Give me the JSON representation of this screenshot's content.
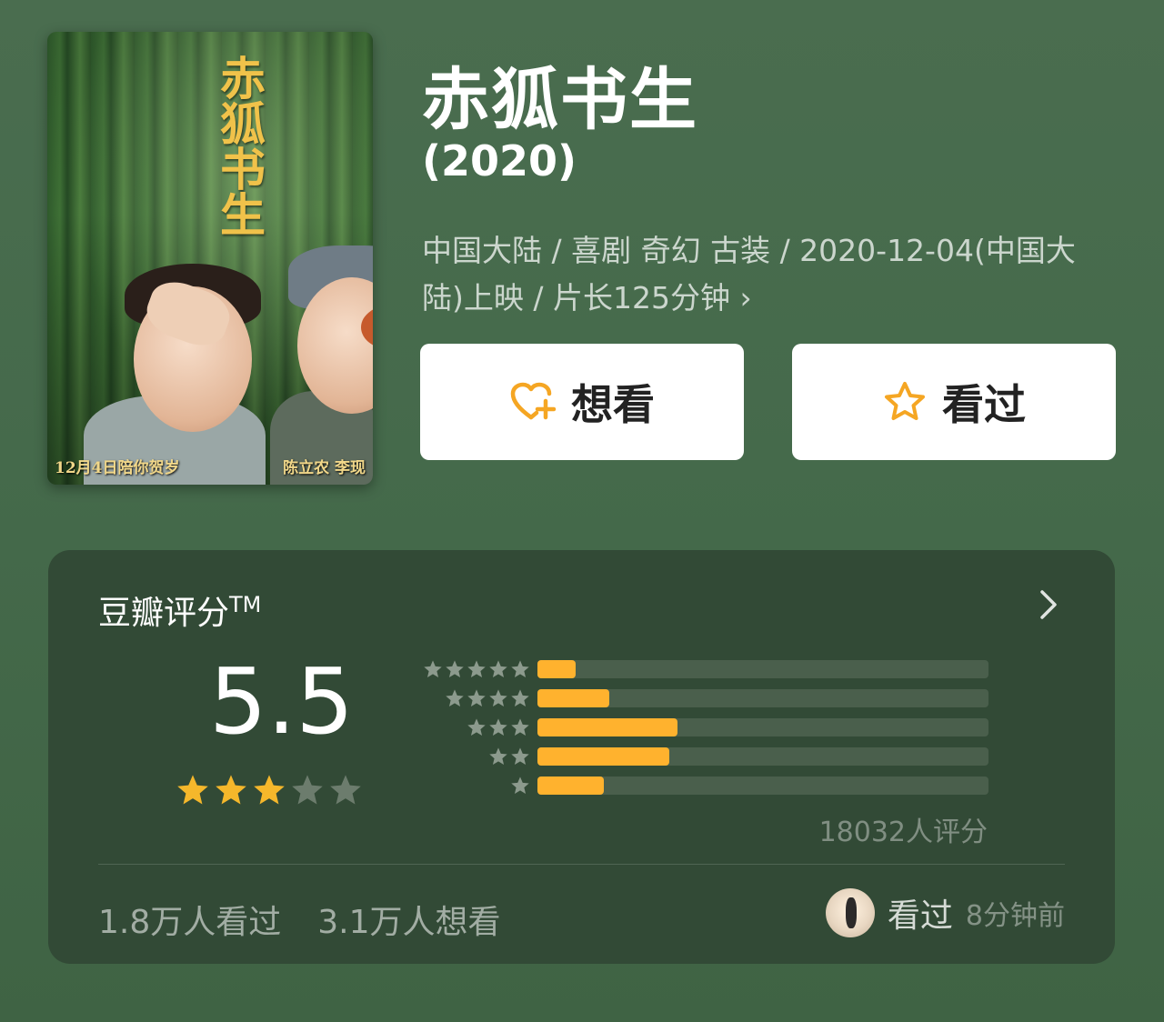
{
  "movie": {
    "title": "赤狐书生",
    "year": "(2020)",
    "meta": "中国大陆 / 喜剧 奇幻 古装 / 2020-12-04(中国大陆)上映 / 片长125分钟 ›",
    "poster": {
      "calligraphy": "赤狐书生",
      "caption_left": "12月4日陪你贺岁",
      "caption_right": "陈立农 李现"
    }
  },
  "actions": {
    "want_label": "想看",
    "seen_label": "看过",
    "want_icon": "heart-plus-icon",
    "seen_icon": "star-outline-icon",
    "accent_color": "#f5a623"
  },
  "rating": {
    "title": "豆瓣评分",
    "title_tm": "TM",
    "score": "5.5",
    "stars_filled": 3,
    "stars_total": 5,
    "distribution": [
      {
        "stars": 5,
        "percent": 8.4
      },
      {
        "stars": 4,
        "percent": 16
      },
      {
        "stars": 3,
        "percent": 31
      },
      {
        "stars": 2,
        "percent": 29.2
      },
      {
        "stars": 1,
        "percent": 14.8
      }
    ],
    "votes": "18032人评分",
    "bar_color": "#ffb22e",
    "star_color": "#f5b72b",
    "empty_star_color": "#6c7c6d"
  },
  "footer": {
    "seen_count": "1.8万人看过",
    "want_count": "3.1万人想看",
    "friend_action": "看过",
    "friend_time": "8分钟前"
  }
}
